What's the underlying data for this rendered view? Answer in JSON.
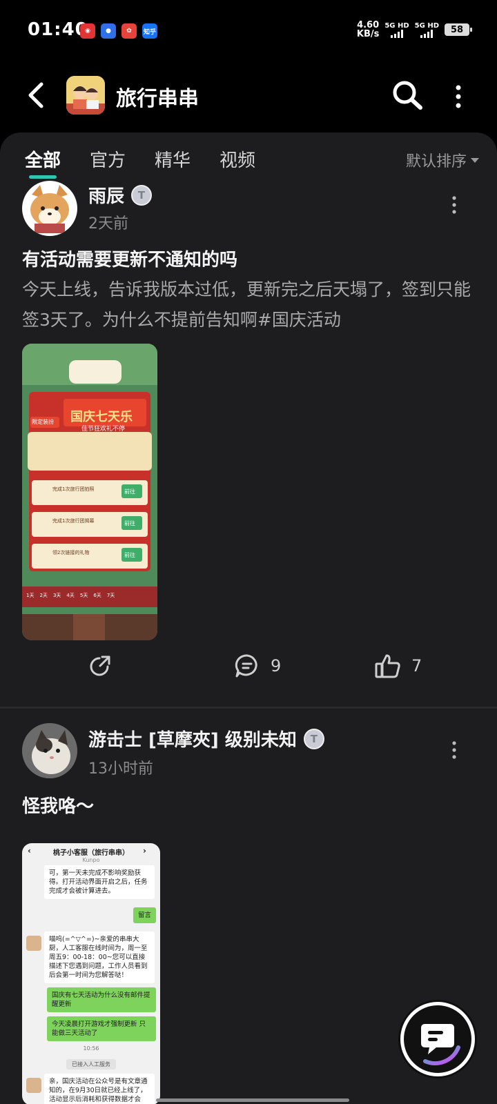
{
  "status_bar": {
    "time": "01:40",
    "app_icons": [
      "netease-music-icon",
      "app-icon",
      "xiaohongshu-icon",
      "zhihu-icon"
    ],
    "zhihu_label": "知乎",
    "speed_value": "4.60",
    "speed_unit": "KB/s",
    "sim1_label": "5G HD",
    "sim2_label": "5G HD",
    "battery": "58"
  },
  "header": {
    "title": "旅行串串"
  },
  "tabs": [
    {
      "label": "全部",
      "active": true
    },
    {
      "label": "官方",
      "active": false
    },
    {
      "label": "精华",
      "active": false
    },
    {
      "label": "视频",
      "active": false
    }
  ],
  "sort_label": "默认排序",
  "posts": [
    {
      "author": "雨辰",
      "level_badge": "T",
      "time": "2天前",
      "title": "有活动需要更新不通知的吗",
      "body": "今天上线，告诉我版本过低，更新完之后天塌了，签到只能签3天了。为什么不提前告知啊#国庆活动",
      "image": {
        "banner": "国庆七天乐",
        "subbanner": "佳节狂欢礼不停",
        "limited_tag": "限定装扮",
        "tasks": [
          "完成1次旅行团拍照",
          "完成1次旅行团揭幕",
          "领2次链接的礼物"
        ],
        "go_label": "前往",
        "days": [
          "1天",
          "2天",
          "3天",
          "4天",
          "5天",
          "6天",
          "7天"
        ]
      },
      "comments": "9",
      "likes": "7"
    },
    {
      "author": "游击士 [草摩夾] 级别未知",
      "level_badge": "T",
      "time": "13小时前",
      "title": "怪我咯～",
      "image": {
        "chat_title": "桃子小客服（旅行串串）",
        "chat_sub": "Kunpo",
        "msgs": [
          {
            "side": "l",
            "text": "可，第一天未完成不影响奖励获得。打开活动界面开启之后，任务完成才会被计算进去。"
          },
          {
            "side": "r",
            "text": "留言"
          },
          {
            "side": "l",
            "text": "喵呜(=^▽^=)~亲爱的串串大厨，人工客服在线时间为，周一至周五9：00-18：00~您可以直接描述下您遇到问题，工作人员看到后会第一时间为您解答哒！"
          },
          {
            "side": "r",
            "text": "国庆有七天活动为什么没有邮件提醒更新"
          },
          {
            "side": "r",
            "text": "今天凌晨打开游戏才强制更新 只能做三天活动了"
          }
        ],
        "time_mark": "10:56",
        "system_note": "已接入人工服务",
        "last_msg": "亲，国庆活动在公众号是有文章通知的，在9月30日就已经上线了，活动显示后消耗和获得数据才会"
      }
    }
  ],
  "colors": {
    "accent": "#2ec4b6",
    "sheet_bg": "#1d1d1f"
  }
}
